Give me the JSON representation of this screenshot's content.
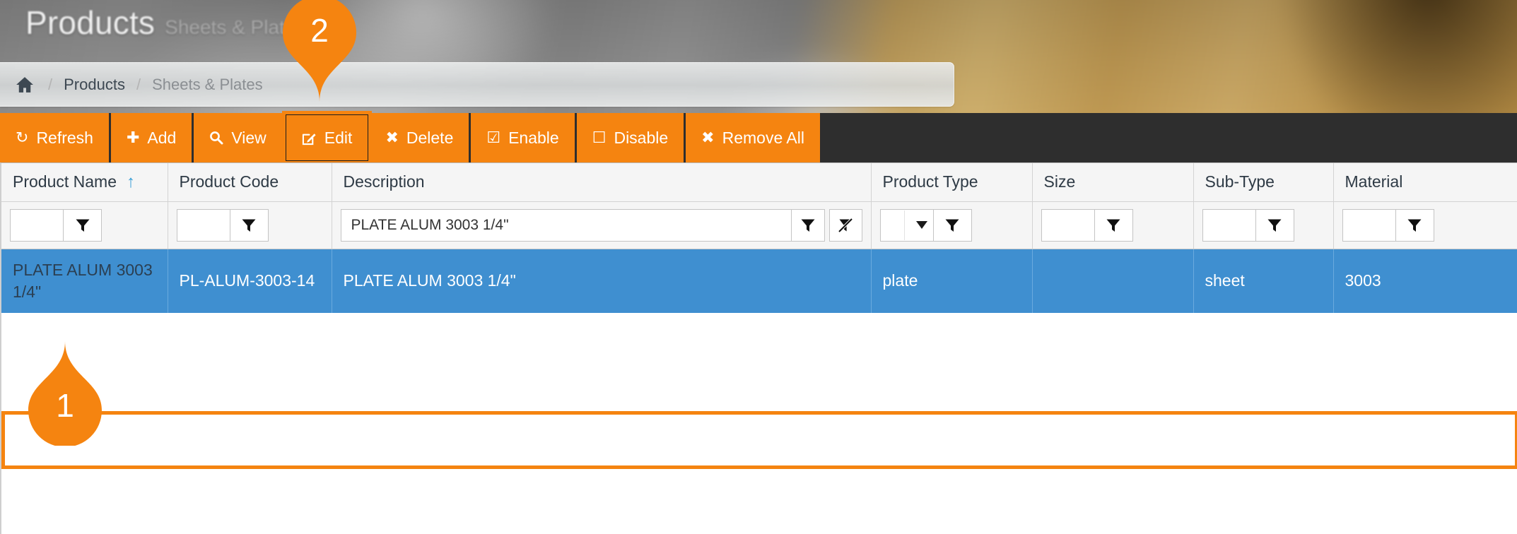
{
  "header": {
    "title": "Products",
    "subtitle": "Sheets & Plates"
  },
  "breadcrumb": {
    "home_icon": "home-icon",
    "separator": "/",
    "items": [
      {
        "label": "Products",
        "current": false
      },
      {
        "label": "Sheets & Plates",
        "current": true
      }
    ]
  },
  "toolbar": {
    "buttons": [
      {
        "label": "Refresh",
        "icon": "refresh-icon",
        "glyph": "↻",
        "highlighted": false
      },
      {
        "label": "Add",
        "icon": "plus-icon",
        "glyph": "✚",
        "highlighted": false
      },
      {
        "label": "View",
        "icon": "magnifier-icon",
        "glyph": "🔍",
        "highlighted": false
      },
      {
        "label": "Edit",
        "icon": "pencil-square-icon",
        "glyph": "✎",
        "highlighted": true
      },
      {
        "label": "Delete",
        "icon": "x-mark-icon",
        "glyph": "✖",
        "highlighted": false
      },
      {
        "label": "Enable",
        "icon": "checked-box-icon",
        "glyph": "☑",
        "highlighted": false
      },
      {
        "label": "Disable",
        "icon": "empty-box-icon",
        "glyph": "☐",
        "highlighted": false
      },
      {
        "label": "Remove All",
        "icon": "x-mark-icon",
        "glyph": "✖",
        "highlighted": false
      }
    ]
  },
  "grid": {
    "columns": [
      {
        "label": "Product Name",
        "sorted": true,
        "sort_direction": "asc",
        "sort_glyph": "↑"
      },
      {
        "label": "Product Code",
        "sorted": false
      },
      {
        "label": "Description",
        "sorted": false
      },
      {
        "label": "Product Type",
        "sorted": false
      },
      {
        "label": "Size",
        "sorted": false
      },
      {
        "label": "Sub-Type",
        "sorted": false
      },
      {
        "label": "Material",
        "sorted": false
      }
    ],
    "filters": [
      {
        "column": "Product Name",
        "type": "text",
        "value": "",
        "placeholder": "",
        "filter_button": "filter-icon",
        "clear_button": null
      },
      {
        "column": "Product Code",
        "type": "text",
        "value": "",
        "placeholder": "",
        "filter_button": "filter-icon",
        "clear_button": null
      },
      {
        "column": "Description",
        "type": "text",
        "value": "PLATE ALUM 3003 1/4\"",
        "placeholder": "",
        "filter_button": "filter-icon",
        "clear_button": "filter-clear-icon"
      },
      {
        "column": "Product Type",
        "type": "select",
        "value": "",
        "placeholder": "",
        "filter_button": "filter-icon",
        "clear_button": null
      },
      {
        "column": "Size",
        "type": "text",
        "value": "",
        "placeholder": "",
        "filter_button": "filter-icon",
        "clear_button": null
      },
      {
        "column": "Sub-Type",
        "type": "text",
        "value": "",
        "placeholder": "",
        "filter_button": "filter-icon",
        "clear_button": null
      },
      {
        "column": "Material",
        "type": "text",
        "value": "",
        "placeholder": "",
        "filter_button": "filter-icon",
        "clear_button": null
      }
    ],
    "rows": [
      {
        "selected": true,
        "highlighted": true,
        "cells": [
          "PLATE ALUM 3003 1/4\"",
          "PL-ALUM-3003-14",
          "PLATE ALUM 3003 1/4\"",
          "plate",
          "",
          "sheet",
          "3003"
        ]
      }
    ]
  },
  "callouts": [
    {
      "number": "1",
      "target": "selected-table-row",
      "direction": "up"
    },
    {
      "number": "2",
      "target": "edit-button",
      "direction": "down"
    }
  ],
  "colors": {
    "accent_orange": "#f58410",
    "toolbar_bg": "#2e2e2e",
    "row_selected_blue": "#3f8fd0",
    "header_grey": "#f5f5f5",
    "sort_arrow_blue": "#3a9fd6"
  }
}
